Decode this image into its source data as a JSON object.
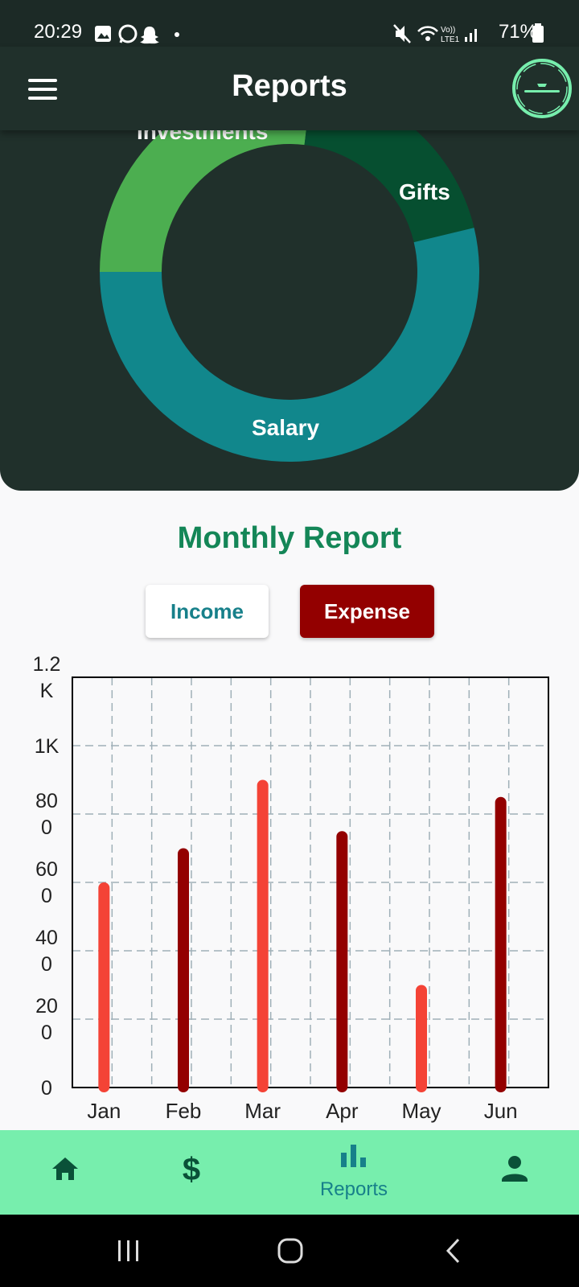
{
  "status_bar": {
    "time": "20:29",
    "battery": "71%",
    "network_label": "Vo)) LTE1"
  },
  "app_bar": {
    "title": "Reports",
    "menu_icon": "hamburger-menu-icon",
    "logo_icon": "app-logo-icon"
  },
  "donut": {
    "segments": [
      {
        "label": "Investments",
        "value": 90,
        "color": "#4cae50"
      },
      {
        "label": "Gifts",
        "value": 65,
        "color": "#064f30"
      },
      {
        "label": "Salary",
        "value": 180,
        "color": "#11878c"
      }
    ]
  },
  "monthly_report": {
    "title": "Monthly Report",
    "income_label": "Income",
    "expense_label": "Expense",
    "selected": "Expense"
  },
  "chart_data": {
    "type": "bar",
    "categories": [
      "Jan",
      "Feb",
      "Mar",
      "Apr",
      "May",
      "Jun"
    ],
    "values": [
      600,
      700,
      900,
      750,
      300,
      850
    ],
    "bar_colors": [
      "#f44336",
      "#930000",
      "#f44336",
      "#930000",
      "#f44336",
      "#930000"
    ],
    "ylim": [
      0,
      1200
    ],
    "yticks": [
      {
        "value": 0,
        "label": [
          "0"
        ]
      },
      {
        "value": 200,
        "label": [
          "20",
          "0"
        ]
      },
      {
        "value": 400,
        "label": [
          "40",
          "0"
        ]
      },
      {
        "value": 600,
        "label": [
          "60",
          "0"
        ]
      },
      {
        "value": 800,
        "label": [
          "80",
          "0"
        ]
      },
      {
        "value": 1000,
        "label": [
          "1K"
        ]
      },
      {
        "value": 1200,
        "label": [
          "1.2",
          "K"
        ]
      }
    ],
    "grid": true
  },
  "bottom_nav": {
    "items": [
      {
        "name": "home",
        "icon": "home-icon",
        "label": ""
      },
      {
        "name": "transactions",
        "icon": "dollar-icon",
        "label": ""
      },
      {
        "name": "reports",
        "icon": "bar-chart-icon",
        "label": "Reports",
        "active": true
      },
      {
        "name": "profile",
        "icon": "person-icon",
        "label": ""
      }
    ],
    "color": "#0a5138",
    "active_color": "#17808a"
  }
}
